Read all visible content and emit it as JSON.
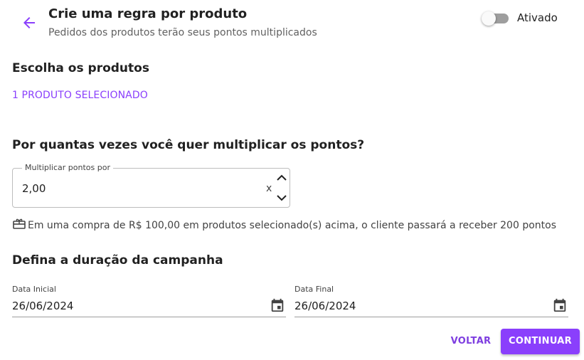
{
  "header": {
    "title": "Crie uma regra por produto",
    "subtitle": "Pedidos dos produtos terão seus pontos multiplicados",
    "back_icon": "arrow-left-icon",
    "toggle": {
      "label": "Ativado",
      "on": false
    }
  },
  "products": {
    "section_title": "Escolha os produtos",
    "selected_link": "1 PRODUTO SELECIONADO"
  },
  "multiplier": {
    "section_title": "Por quantas vezes você quer multiplicar os pontos?",
    "field_label": "Multiplicar pontos por",
    "value": "2,00",
    "suffix": "x",
    "info_icon": "gift-card-icon",
    "info_text": "Em uma compra de R$ 100,00 em produtos selecionado(s) acima, o cliente passará a receber 200 pontos"
  },
  "duration": {
    "section_title": "Defina a duração da campanha",
    "start": {
      "label": "Data Inicial",
      "value": "26/06/2024"
    },
    "end": {
      "label": "Data Final",
      "value": "26/06/2024"
    },
    "calendar_icon": "calendar-icon"
  },
  "actions": {
    "back_label": "VOLTAR",
    "continue_label": "CONTINUAR"
  },
  "colors": {
    "accent": "#8a3ffc",
    "text": "#212121",
    "muted": "#616161"
  }
}
